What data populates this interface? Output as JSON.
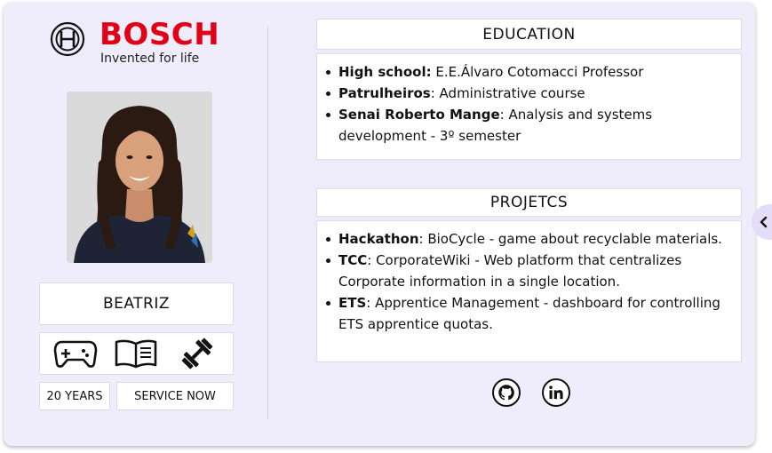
{
  "brand": {
    "name": "BOSCH",
    "tagline": "Invented for life",
    "color": "#e20015"
  },
  "profile": {
    "name": "BEATRIZ",
    "age": "20 YEARS",
    "service": "SERVICE NOW",
    "hobbies": [
      "gamepad-icon",
      "book-icon",
      "dumbbell-icon"
    ]
  },
  "education": {
    "title": "EDUCATION",
    "items": [
      {
        "label": "High school:",
        "text": " E.E.Álvaro Cotomacci Professor"
      },
      {
        "label": "Patrulheiros",
        "text": ": Administrative course"
      },
      {
        "label": "Senai Roberto Mange",
        "text": ": Analysis and systems development - 3º semester"
      }
    ]
  },
  "projects": {
    "title": "PROJETCS",
    "items": [
      {
        "label": "Hackathon",
        "text": ": BioCycle - game about recyclable materials."
      },
      {
        "label": "TCC",
        "text": ": CorporateWiki -  Web platform that centralizes Corporate information in a single location."
      },
      {
        "label": "ETS",
        "text": ":  Apprentice Management - dashboard for controlling ETS apprentice quotas."
      }
    ]
  },
  "social": [
    "github-icon",
    "linkedin-icon"
  ],
  "colors": {
    "card_bg": "#efecfc",
    "tab_bg": "#e3ddfa"
  }
}
